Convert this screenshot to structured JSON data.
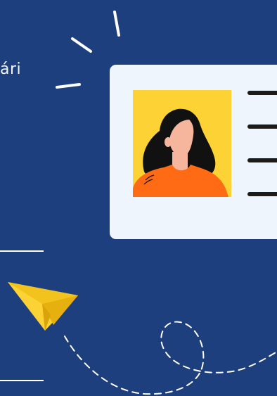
{
  "page": {
    "fragment_text": "ári"
  },
  "colors": {
    "background": "#1e3f7e",
    "card": "#eef5fd",
    "photo_bg": "#fdd235",
    "hair": "#111111",
    "skin": "#f6b59d",
    "shirt": "#ff6a14",
    "plane": "#fdd235",
    "card_lines": "#1b1b1b",
    "accents": "#ffffff"
  },
  "icons": {
    "card": "id-card-icon",
    "avatar": "person-avatar-icon",
    "plane": "paper-plane-icon",
    "burst": "sparkle-burst-icon",
    "trail": "dashed-flight-path"
  }
}
